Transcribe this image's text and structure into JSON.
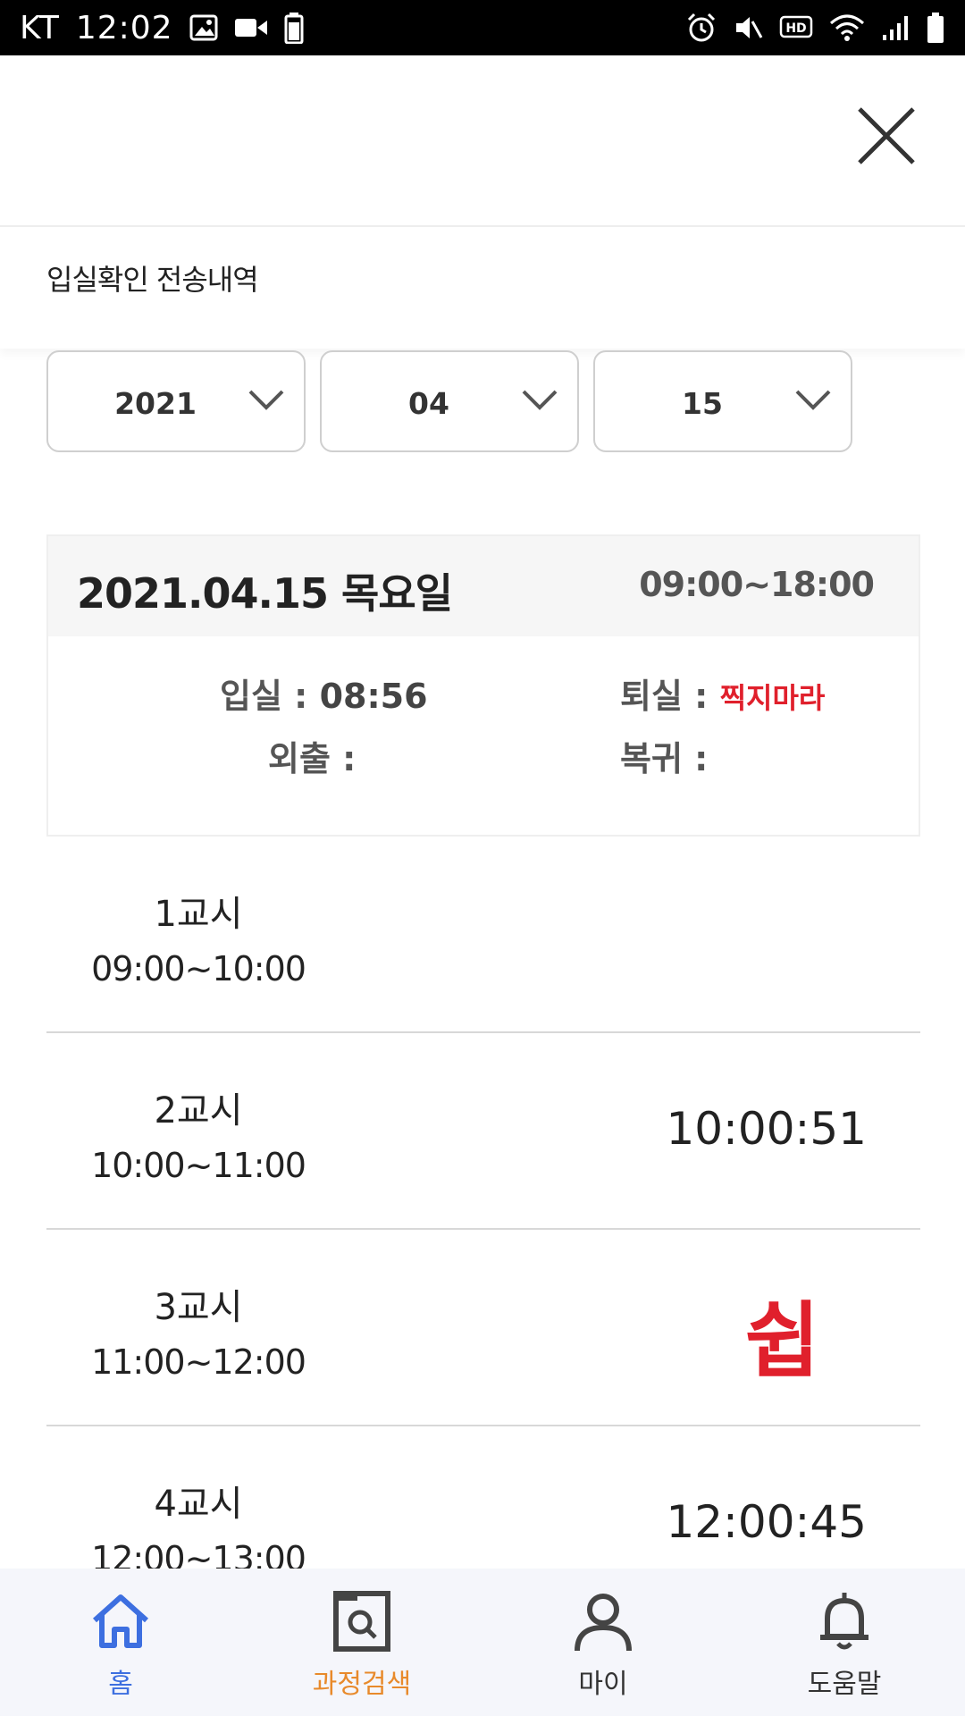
{
  "status_bar": {
    "carrier": "KT",
    "time": "12:02"
  },
  "section": {
    "title": "입실확인 전송내역"
  },
  "filters": {
    "year": "2021",
    "month": "04",
    "day": "15"
  },
  "day": {
    "date": "2021.04.15 목요일",
    "hours": "09:00~18:00",
    "checkin_label": "입실 :",
    "checkin_value": "08:56",
    "checkout_label": "퇴실 :",
    "checkout_value": "찍지마라",
    "out_label": "외출 :",
    "return_label": "복귀 :"
  },
  "periods": [
    {
      "name": "1교시",
      "range": "09:00~10:00",
      "value": ""
    },
    {
      "name": "2교시",
      "range": "10:00~11:00",
      "value": "10:00:51"
    },
    {
      "name": "3교시",
      "range": "11:00~12:00",
      "value": "쉽"
    },
    {
      "name": "4교시",
      "range": "12:00~13:00",
      "value": "12:00:45"
    }
  ],
  "nav": {
    "home": "홈",
    "course_search": "과정검색",
    "my": "마이",
    "help": "도움말"
  },
  "colors": {
    "accent_blue": "#3d6fe0",
    "accent_orange": "#e88a2b",
    "alert_red": "#e0202c"
  }
}
